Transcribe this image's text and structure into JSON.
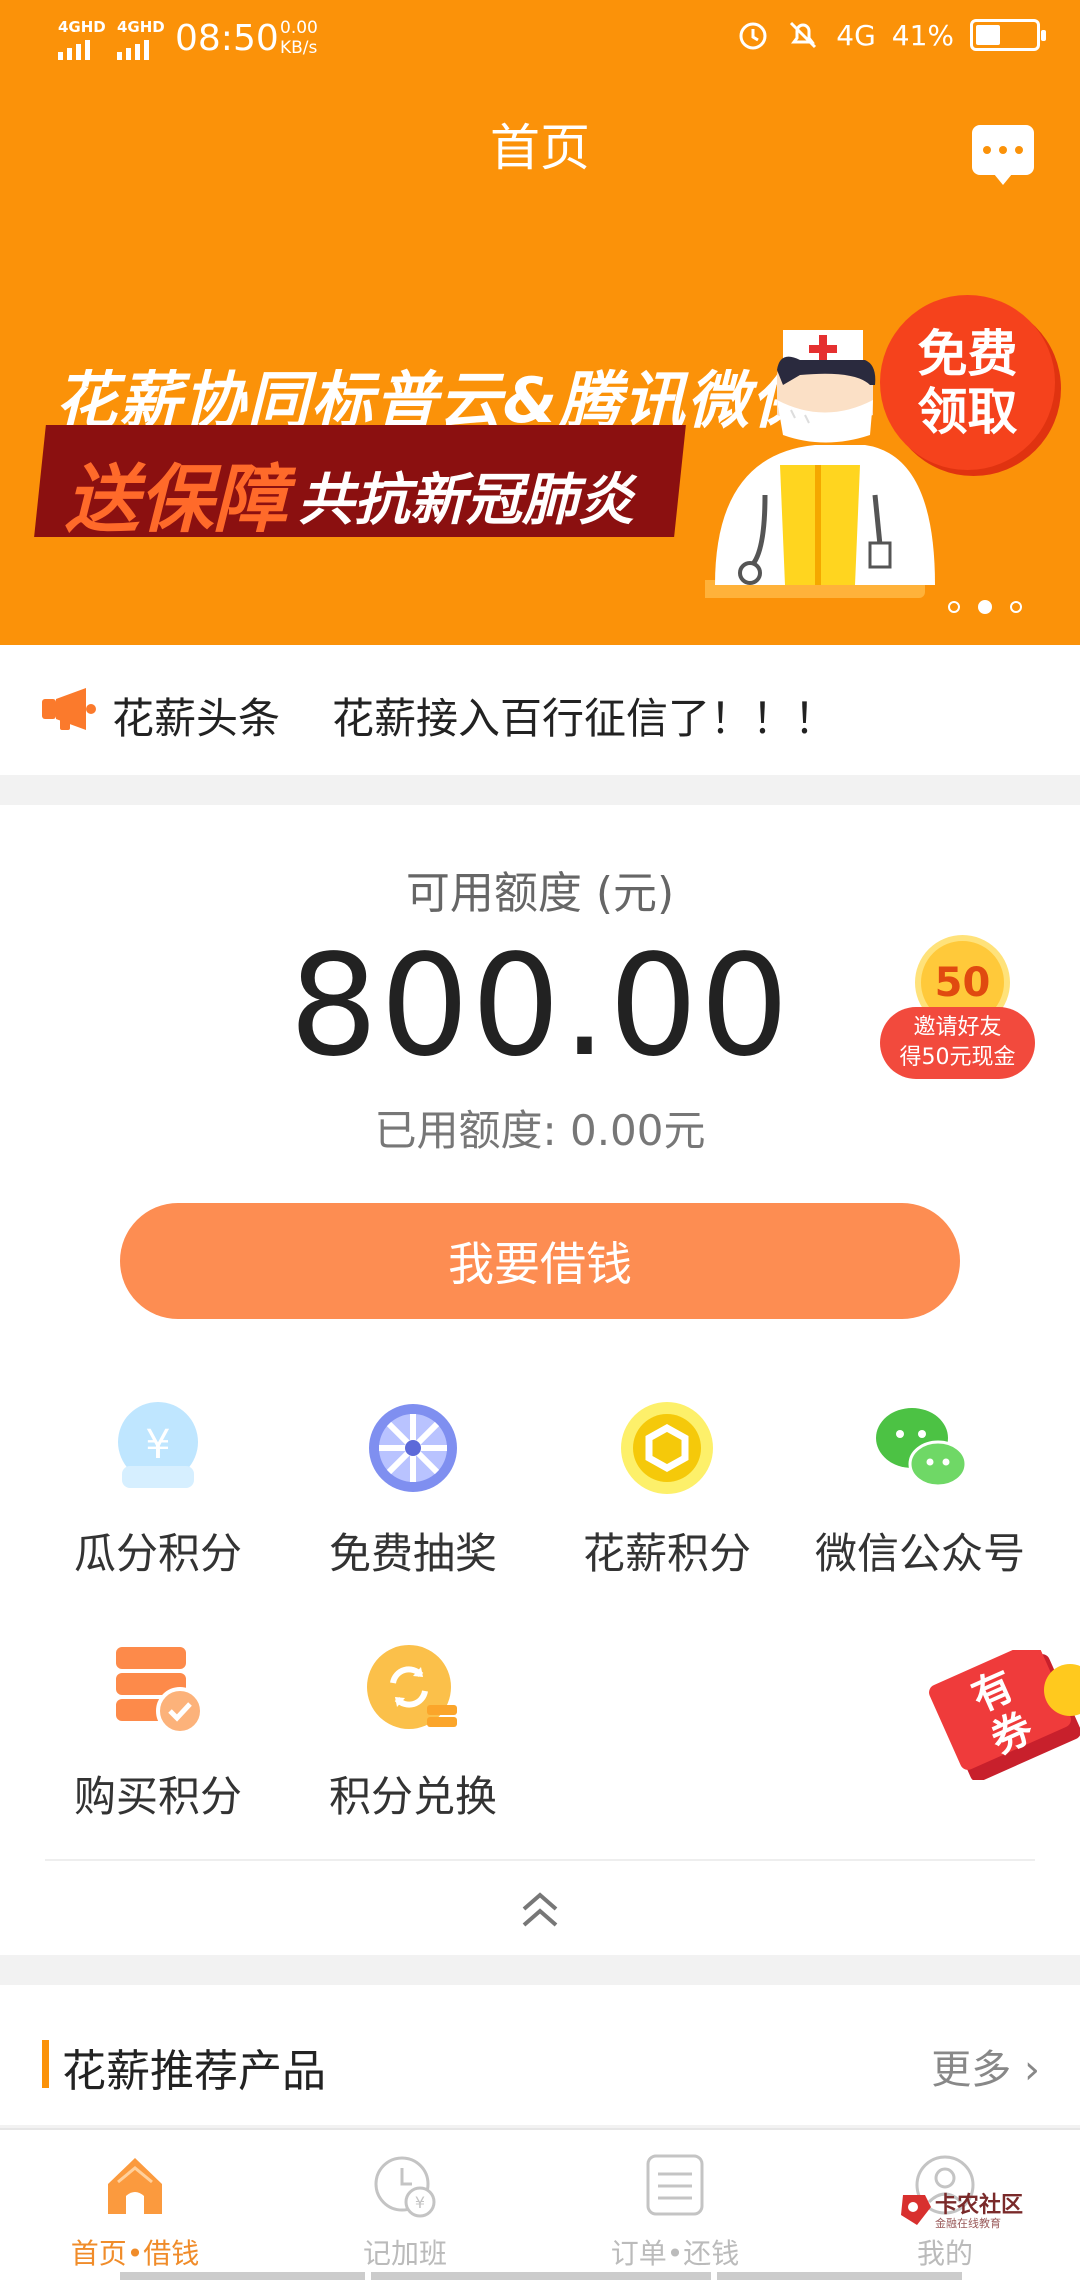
{
  "status_bar": {
    "sim1": "4GHD",
    "sim2": "4GHD",
    "time": "08:50",
    "speed_value": "0.00",
    "speed_unit": "KB/s",
    "network": "4G",
    "battery": "41%",
    "battery_level": 0.41
  },
  "header": {
    "title": "首页",
    "message_icon": "chat-bubble-icon"
  },
  "banner": {
    "line1": "花薪协同标普云&腾讯微保",
    "line2_highlight": "送保障",
    "line2_rest": "共抗新冠肺炎",
    "badge": "免费\n领取",
    "active_slide": 2,
    "slide_count": 3
  },
  "news": {
    "label": "花薪头条",
    "text": "花薪接入百行征信了！！！",
    "icon": "megaphone-icon"
  },
  "credit": {
    "label": "可用额度 (元)",
    "amount": "800.00",
    "used": "已用额度: 0.00元",
    "invite_badge": "50",
    "invite_line1": "邀请好友",
    "invite_line2": "得50元现金",
    "borrow_button": "我要借钱"
  },
  "features": [
    {
      "label": "瓜分积分",
      "icon": "yuan-bowl-icon"
    },
    {
      "label": "免费抽奖",
      "icon": "prize-wheel-icon"
    },
    {
      "label": "花薪积分",
      "icon": "points-coin-icon"
    },
    {
      "label": "微信公众号",
      "icon": "wechat-icon"
    },
    {
      "label": "购买积分",
      "icon": "buy-points-icon"
    },
    {
      "label": "积分兑换",
      "icon": "exchange-icon"
    }
  ],
  "coupon": {
    "label": "有券"
  },
  "recommended": {
    "title": "花薪推荐产品",
    "more": "更多"
  },
  "tabbar": [
    {
      "label": "首页•借钱",
      "icon": "home-icon",
      "active": true
    },
    {
      "label": "记加班",
      "icon": "clock-yuan-icon",
      "active": false
    },
    {
      "label": "订单•还钱",
      "icon": "order-list-icon",
      "active": false
    },
    {
      "label": "我的",
      "icon": "profile-icon",
      "active": false
    }
  ],
  "watermark": {
    "title": "卡农社区",
    "subtitle": "金融在线教育"
  },
  "colors": {
    "brand_orange": "#fb9209",
    "button_orange": "#fd8d52",
    "active_tab": "#f08c2a"
  }
}
